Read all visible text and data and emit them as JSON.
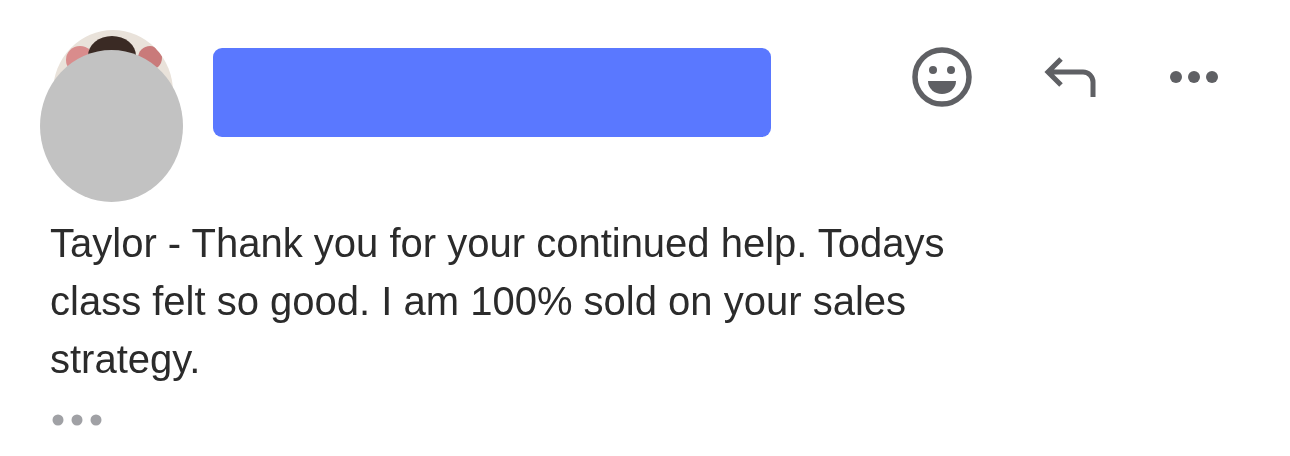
{
  "message": {
    "body": "Taylor - Thank you for your continued help. Todays class felt so good. I am 100% sold on your sales strategy."
  }
}
